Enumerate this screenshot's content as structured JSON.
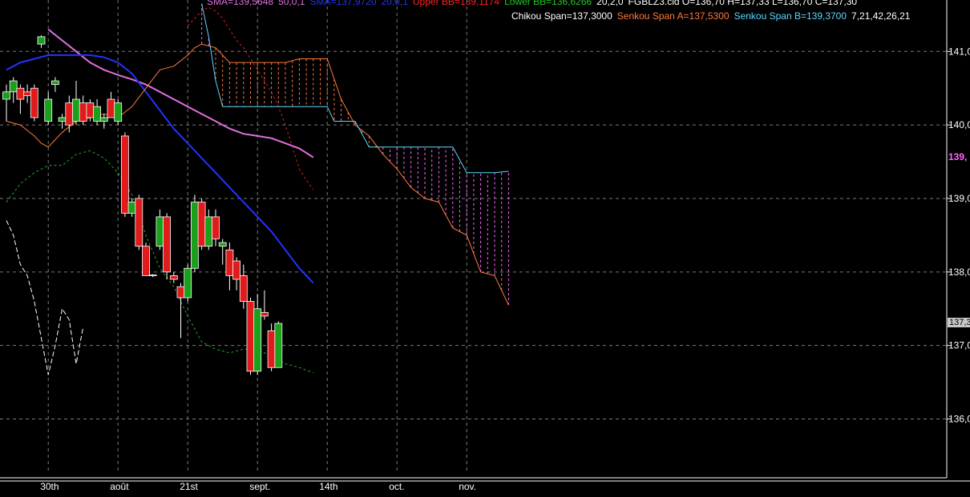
{
  "legend_line1": [
    {
      "text": "SMA=139,5648",
      "color": "#e070e0"
    },
    {
      "text": "50,0,1",
      "color": "#e070e0"
    },
    {
      "text": "SMA=137,9720",
      "color": "#2233ff"
    },
    {
      "text": "20,0,1",
      "color": "#2233ff"
    },
    {
      "text": "Upper BB=139,1174",
      "color": "#ff2222"
    },
    {
      "text": "Lower BB=136,6266",
      "color": "#22cc22"
    },
    {
      "text": "20,2,0",
      "color": "#ffffff"
    },
    {
      "text": "FGBLZ3.cld O=136,70 H=137,33 L=136,70 C=137,30",
      "color": "#ffffff"
    }
  ],
  "legend_line2": [
    {
      "text": "Chikou Span=137,3000",
      "color": "#ffffff"
    },
    {
      "text": "Senkou Span A=137,5300",
      "color": "#ff7a3d"
    },
    {
      "text": "Senkou Span B=139,3700",
      "color": "#5fd7ff"
    },
    {
      "text": "7,21,42,26,21",
      "color": "#ffffff"
    }
  ],
  "price_tag_sma50": {
    "text": "139,",
    "color": "#ff66ff",
    "value": 139.56
  },
  "close_tag": {
    "text": "137,3",
    "value": 137.3
  },
  "chart_data": {
    "type": "candlestick",
    "ylim": [
      135.2,
      141.7
    ],
    "y_ticks": [
      {
        "value": 136,
        "label": "136,0"
      },
      {
        "value": 137,
        "label": "137,0"
      },
      {
        "value": 138,
        "label": "138,0"
      },
      {
        "value": 139,
        "label": "139,0"
      },
      {
        "value": 140,
        "label": "140,0"
      },
      {
        "value": 141,
        "label": "141,0"
      }
    ],
    "x_range": [
      0,
      136
    ],
    "x_labels": [
      {
        "x": 6,
        "label": "30th"
      },
      {
        "x": 16,
        "label": "août"
      },
      {
        "x": 26,
        "label": "21st"
      },
      {
        "x": 36,
        "label": "sept."
      },
      {
        "x": 46,
        "label": "14th"
      },
      {
        "x": 56,
        "label": "oct."
      },
      {
        "x": 66,
        "label": "nov."
      }
    ],
    "grid": true,
    "candles": [
      {
        "x": 0,
        "o": 140.35,
        "h": 140.55,
        "l": 140.05,
        "c": 140.45
      },
      {
        "x": 1,
        "o": 140.45,
        "h": 140.65,
        "l": 140.3,
        "c": 140.6
      },
      {
        "x": 2,
        "o": 140.5,
        "h": 140.55,
        "l": 140.15,
        "c": 140.35
      },
      {
        "x": 3,
        "o": 140.45,
        "h": 140.55,
        "l": 140.3,
        "c": 140.4
      },
      {
        "x": 4,
        "o": 140.5,
        "h": 140.55,
        "l": 140.05,
        "c": 140.1
      },
      {
        "x": 5,
        "o": 141.1,
        "h": 141.22,
        "l": 141.05,
        "c": 141.2
      },
      {
        "x": 6,
        "o": 140.05,
        "h": 140.45,
        "l": 140.0,
        "c": 140.35
      },
      {
        "x": 7,
        "o": 140.55,
        "h": 140.65,
        "l": 140.45,
        "c": 140.6
      },
      {
        "x": 8,
        "o": 140.05,
        "h": 140.15,
        "l": 139.95,
        "c": 140.1
      },
      {
        "x": 9,
        "o": 140.3,
        "h": 140.4,
        "l": 139.9,
        "c": 140.0
      },
      {
        "x": 10,
        "o": 140.05,
        "h": 140.6,
        "l": 140.0,
        "c": 140.35
      },
      {
        "x": 11,
        "o": 140.3,
        "h": 140.4,
        "l": 140.0,
        "c": 140.05
      },
      {
        "x": 12,
        "o": 140.3,
        "h": 140.35,
        "l": 140.05,
        "c": 140.1
      },
      {
        "x": 13,
        "o": 140.05,
        "h": 140.35,
        "l": 140.0,
        "c": 140.25
      },
      {
        "x": 14,
        "o": 140.05,
        "h": 140.15,
        "l": 139.95,
        "c": 140.1
      },
      {
        "x": 15,
        "o": 140.35,
        "h": 140.45,
        "l": 140.1,
        "c": 140.1
      },
      {
        "x": 16,
        "o": 140.05,
        "h": 140.35,
        "l": 140.0,
        "c": 140.3
      },
      {
        "x": 17,
        "o": 139.85,
        "h": 139.9,
        "l": 138.75,
        "c": 138.8
      },
      {
        "x": 18,
        "o": 138.8,
        "h": 139.0,
        "l": 138.75,
        "c": 138.95
      },
      {
        "x": 19,
        "o": 139.0,
        "h": 139.05,
        "l": 138.3,
        "c": 138.35
      },
      {
        "x": 20,
        "o": 138.35,
        "h": 138.4,
        "l": 137.95,
        "c": 137.95
      },
      {
        "x": 21,
        "o": 137.95,
        "h": 137.97,
        "l": 137.93,
        "c": 137.96
      },
      {
        "x": 22,
        "o": 138.35,
        "h": 138.85,
        "l": 138.3,
        "c": 138.75
      },
      {
        "x": 23,
        "o": 138.75,
        "h": 138.8,
        "l": 137.9,
        "c": 138.0
      },
      {
        "x": 24,
        "o": 137.95,
        "h": 138.0,
        "l": 137.85,
        "c": 137.9
      },
      {
        "x": 25,
        "o": 137.8,
        "h": 137.85,
        "l": 137.1,
        "c": 137.65
      },
      {
        "x": 26,
        "o": 137.65,
        "h": 138.1,
        "l": 137.6,
        "c": 138.05
      },
      {
        "x": 27,
        "o": 138.05,
        "h": 139.05,
        "l": 138.0,
        "c": 138.95
      },
      {
        "x": 28,
        "o": 138.95,
        "h": 139.0,
        "l": 138.3,
        "c": 138.35
      },
      {
        "x": 29,
        "o": 138.35,
        "h": 138.85,
        "l": 138.3,
        "c": 138.75
      },
      {
        "x": 30,
        "o": 138.75,
        "h": 138.85,
        "l": 138.35,
        "c": 138.45
      },
      {
        "x": 31,
        "o": 138.35,
        "h": 138.45,
        "l": 138.1,
        "c": 138.4
      },
      {
        "x": 32,
        "o": 138.3,
        "h": 138.4,
        "l": 137.75,
        "c": 137.95
      },
      {
        "x": 33,
        "o": 138.15,
        "h": 138.2,
        "l": 137.75,
        "c": 137.9
      },
      {
        "x": 34,
        "o": 137.95,
        "h": 138.1,
        "l": 137.5,
        "c": 137.6
      },
      {
        "x": 35,
        "o": 137.6,
        "h": 137.65,
        "l": 136.6,
        "c": 136.65
      },
      {
        "x": 36,
        "o": 136.65,
        "h": 137.7,
        "l": 136.6,
        "c": 137.5
      },
      {
        "x": 37,
        "o": 137.45,
        "h": 137.75,
        "l": 137.35,
        "c": 137.4
      },
      {
        "x": 38,
        "o": 137.2,
        "h": 137.3,
        "l": 136.65,
        "c": 136.7
      },
      {
        "x": 39,
        "o": 136.7,
        "h": 137.33,
        "l": 136.7,
        "c": 137.3
      }
    ],
    "series": [
      {
        "name": "SMA",
        "color": "#e070e0",
        "dash": "",
        "width": 2,
        "x": [
          6,
          8,
          10,
          12,
          14,
          16,
          18,
          20,
          22,
          24,
          26,
          28,
          30,
          32,
          34,
          36,
          38,
          40,
          42,
          44
        ],
        "y": [
          141.3,
          141.15,
          141.0,
          140.85,
          140.75,
          140.68,
          140.62,
          140.55,
          140.45,
          140.35,
          140.25,
          140.15,
          140.05,
          139.95,
          139.88,
          139.85,
          139.82,
          139.75,
          139.68,
          139.56
        ]
      },
      {
        "name": "SMA",
        "color": "#2233ff",
        "dash": "",
        "width": 2,
        "x": [
          0,
          2,
          4,
          6,
          8,
          10,
          12,
          14,
          16,
          18,
          20,
          22,
          24,
          26,
          28,
          30,
          32,
          34,
          36,
          38,
          40,
          42,
          44
        ],
        "y": [
          140.75,
          140.85,
          140.9,
          140.95,
          140.95,
          140.95,
          140.95,
          140.92,
          140.85,
          140.7,
          140.45,
          140.2,
          139.95,
          139.75,
          139.55,
          139.35,
          139.15,
          138.95,
          138.75,
          138.55,
          138.3,
          138.05,
          137.85
        ]
      },
      {
        "name": "Upper BB",
        "color": "#cc2222",
        "dash": "3,3",
        "width": 1,
        "x": [
          26,
          27,
          28,
          29,
          30,
          31,
          32,
          33,
          34,
          35,
          36,
          37,
          38,
          39,
          40,
          41,
          42,
          43,
          44
        ],
        "y": [
          141.35,
          141.45,
          141.55,
          141.6,
          141.55,
          141.45,
          141.3,
          141.15,
          141.05,
          140.9,
          140.75,
          140.6,
          140.45,
          140.25,
          140.0,
          139.7,
          139.4,
          139.25,
          139.12
        ]
      },
      {
        "name": "Lower BB",
        "color": "#22aa22",
        "dash": "3,3",
        "width": 1,
        "x": [
          0,
          2,
          4,
          6,
          8,
          10,
          12,
          14,
          16,
          18,
          20,
          22,
          24,
          26,
          28,
          30,
          32,
          34,
          36,
          38,
          40,
          42,
          44
        ],
        "y": [
          138.95,
          139.2,
          139.35,
          139.45,
          139.45,
          139.6,
          139.65,
          139.55,
          139.35,
          139.05,
          138.5,
          138.05,
          137.8,
          137.4,
          137.05,
          136.95,
          136.9,
          136.95,
          136.95,
          136.85,
          136.75,
          136.7,
          136.63
        ]
      },
      {
        "name": "Chikou Span",
        "color": "#ffffff",
        "dash": "6,3",
        "width": 1,
        "x": [
          0,
          1,
          2,
          3,
          4,
          5,
          6,
          7,
          8,
          9,
          10,
          11
        ],
        "y": [
          138.7,
          138.5,
          138.1,
          137.95,
          137.6,
          137.1,
          136.6,
          137.0,
          137.5,
          137.35,
          136.75,
          137.25
        ]
      },
      {
        "name": "Senkou Span A",
        "color": "#ff7a3d",
        "dash": "",
        "width": 1,
        "x": [
          0,
          2,
          4,
          5,
          6,
          8,
          10,
          12,
          14,
          16,
          18,
          20,
          22,
          24,
          26,
          27,
          28,
          30,
          32,
          34,
          36,
          38,
          40,
          42,
          44,
          46,
          48,
          50,
          52,
          54,
          56,
          58,
          60,
          62,
          64,
          66,
          68,
          70,
          72
        ],
        "y": [
          140.05,
          140.0,
          139.85,
          139.75,
          139.7,
          139.9,
          140.05,
          140.1,
          140.15,
          140.1,
          140.25,
          140.5,
          140.75,
          140.8,
          140.95,
          141.05,
          141.1,
          141.05,
          140.85,
          140.85,
          140.85,
          140.85,
          140.85,
          140.9,
          140.9,
          140.9,
          140.35,
          140.0,
          139.85,
          139.6,
          139.4,
          139.15,
          139.0,
          138.95,
          138.6,
          138.5,
          138.0,
          137.95,
          137.55
        ]
      },
      {
        "name": "Senkou Span B",
        "color": "#5fd7ff",
        "dash": "",
        "width": 1,
        "x": [
          28,
          29,
          30,
          31,
          32,
          36,
          40,
          44,
          46,
          47,
          48,
          50,
          52,
          54,
          56,
          58,
          60,
          62,
          64,
          66,
          68,
          70,
          72
        ],
        "y": [
          141.65,
          141.2,
          140.6,
          140.25,
          140.25,
          140.25,
          140.25,
          140.25,
          140.25,
          140.05,
          140.05,
          140.05,
          139.7,
          139.7,
          139.7,
          139.7,
          139.7,
          139.7,
          139.7,
          139.35,
          139.35,
          139.35,
          139.37
        ]
      }
    ]
  }
}
